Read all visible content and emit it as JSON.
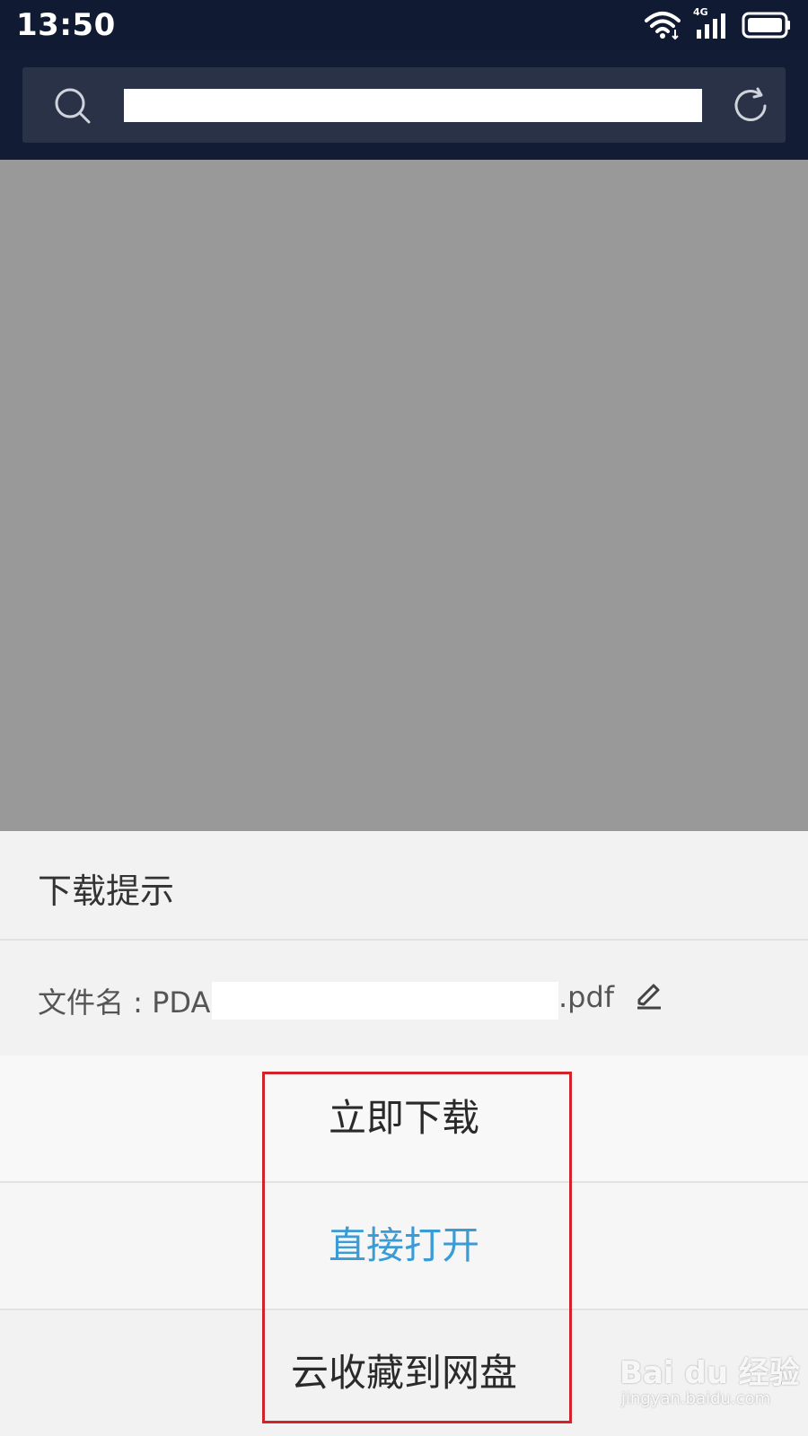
{
  "status_bar": {
    "time": "13:50",
    "network_label": "4G",
    "icons": [
      "wifi-icon",
      "cellular-signal-icon",
      "battery-icon"
    ]
  },
  "address_bar": {
    "search_icon": "search-icon",
    "refresh_icon": "refresh-icon"
  },
  "dialog": {
    "title": "下载提示",
    "filename_label": "文件名 : PDA",
    "filename_extension": ".pdf",
    "edit_icon": "pencil-icon",
    "options": [
      {
        "label": "立即下载"
      },
      {
        "label": "直接打开"
      },
      {
        "label": "云收藏到网盘"
      }
    ]
  },
  "colors": {
    "status_bar_bg": "#111a33",
    "open_option_text": "#3a9bd5",
    "annotation_red": "#d0232a",
    "overlay_gray": "#999999"
  },
  "watermark": {
    "logo_text": "Bai du 经验",
    "url_text": "jingyan.baidu.com"
  }
}
